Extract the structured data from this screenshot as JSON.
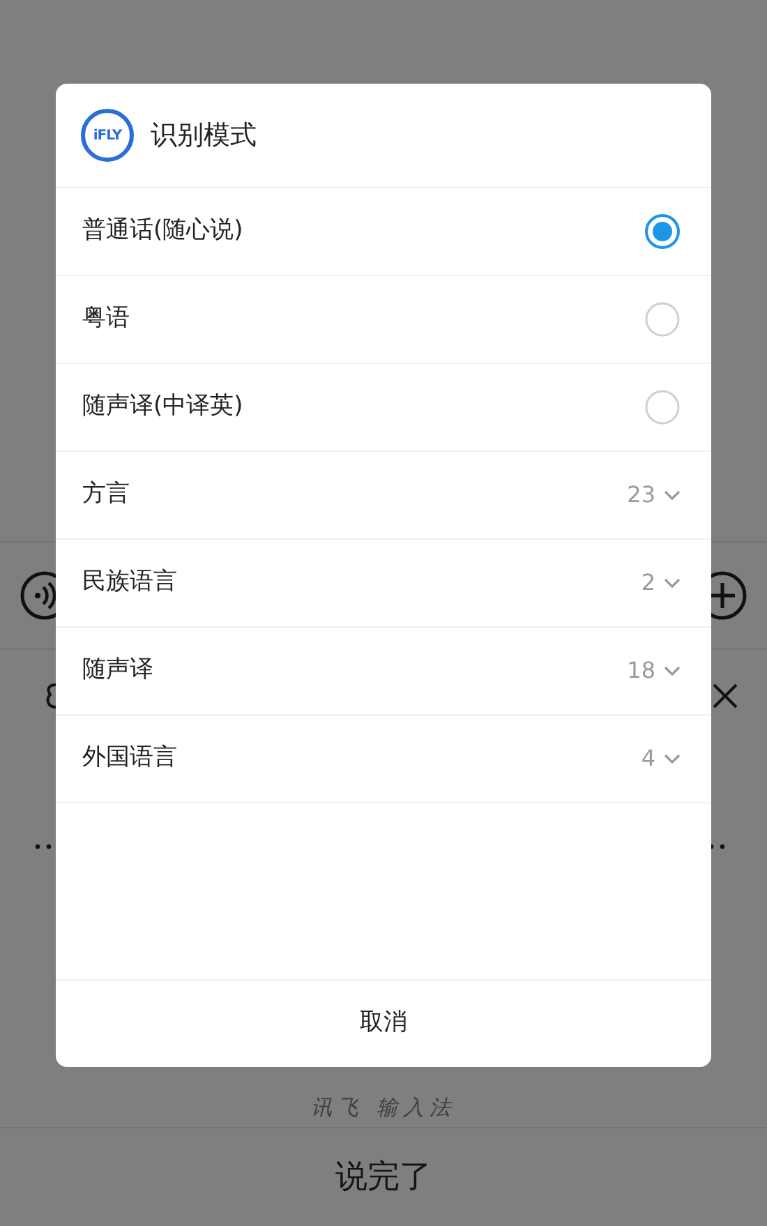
{
  "dialog": {
    "logo": "iFLY",
    "title": "识别模式",
    "options": [
      {
        "kind": "radio",
        "label": "普通话(随心说)",
        "selected": true
      },
      {
        "kind": "radio",
        "label": "粤语",
        "selected": false
      },
      {
        "kind": "radio",
        "label": "随声译(中译英)",
        "selected": false
      },
      {
        "kind": "submenu",
        "label": "方言",
        "count": "23"
      },
      {
        "kind": "submenu",
        "label": "民族语言",
        "count": "2"
      },
      {
        "kind": "submenu",
        "label": "随声译",
        "count": "18"
      },
      {
        "kind": "submenu",
        "label": "外国语言",
        "count": "4"
      }
    ],
    "cancel": "取消"
  },
  "keyboard": {
    "brand": "讯飞 输入法",
    "done": "说完了"
  }
}
